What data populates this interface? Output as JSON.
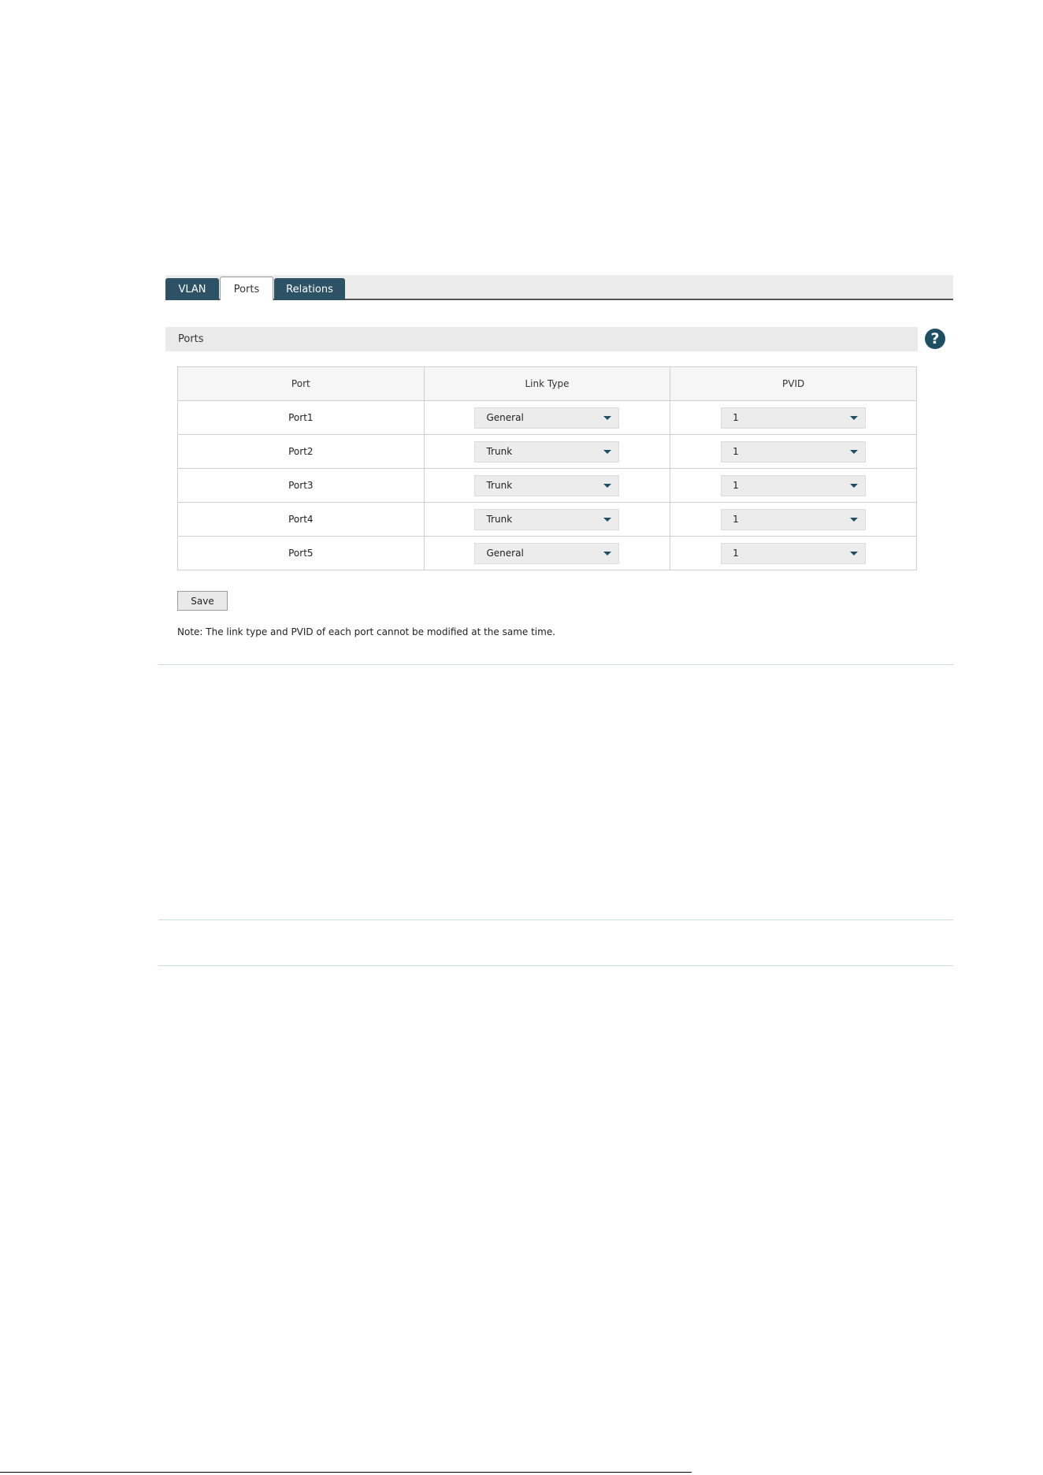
{
  "tabs": [
    {
      "label": "VLAN",
      "active": false
    },
    {
      "label": "Ports",
      "active": true
    },
    {
      "label": "Relations",
      "active": false
    }
  ],
  "section": {
    "title": "Ports",
    "help_icon": "question-circle-icon"
  },
  "table": {
    "headers": [
      "Port",
      "Link Type",
      "PVID"
    ],
    "rows": [
      {
        "port": "Port1",
        "link_type": "General",
        "pvid": "1"
      },
      {
        "port": "Port2",
        "link_type": "Trunk",
        "pvid": "1"
      },
      {
        "port": "Port3",
        "link_type": "Trunk",
        "pvid": "1"
      },
      {
        "port": "Port4",
        "link_type": "Trunk",
        "pvid": "1"
      },
      {
        "port": "Port5",
        "link_type": "General",
        "pvid": "1"
      }
    ]
  },
  "actions": {
    "save_label": "Save"
  },
  "note": "Note: The link type and PVID of each port cannot be modified at the same time.",
  "colors": {
    "accent": "#2d5266",
    "help_icon": "#1f4f62",
    "section_bg": "#eaeaea"
  }
}
